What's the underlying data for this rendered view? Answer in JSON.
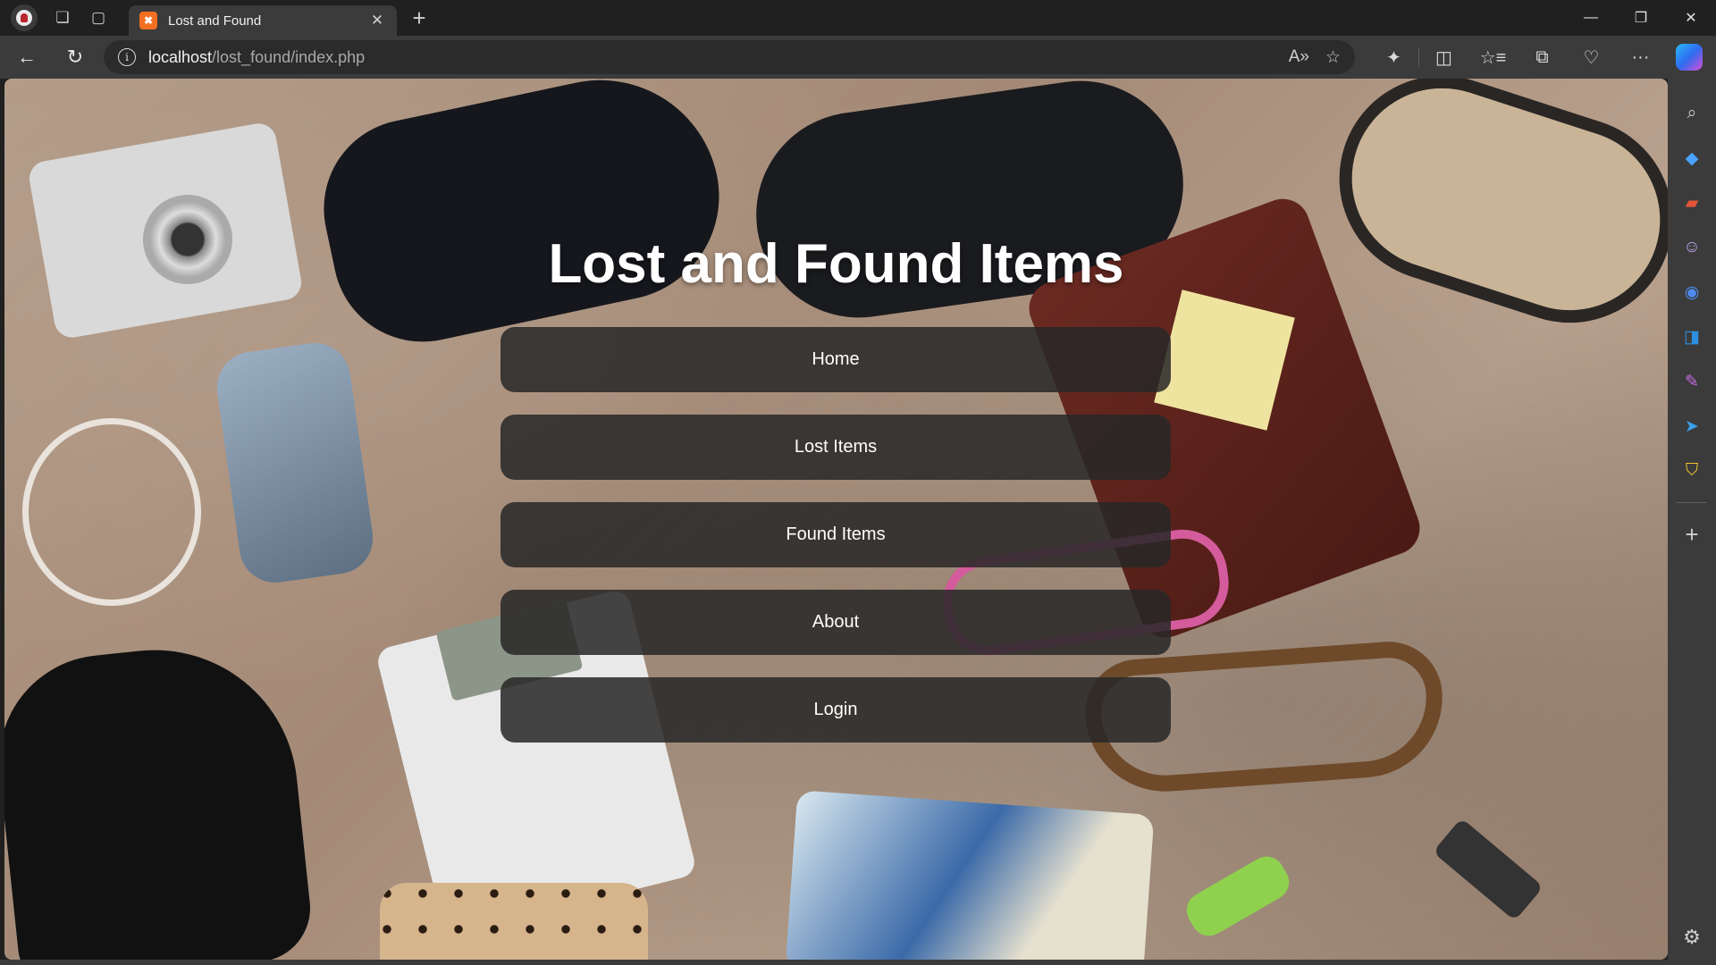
{
  "browser": {
    "tab": {
      "title": "Lost and Found",
      "favicon_text": "✖"
    },
    "address": {
      "host": "localhost",
      "path": "/lost_found/index.php"
    },
    "window_controls": {
      "minimize": "—",
      "restore": "❐",
      "close": "✕"
    },
    "nav": {
      "back": "←",
      "reload": "↻"
    },
    "omnibox_icons": {
      "read_aloud": "A»",
      "favorite": "☆"
    },
    "toolbar_icons": {
      "extensions": "✦",
      "split": "◫",
      "favorites": "☆≡",
      "collections": "⧉",
      "health": "♡",
      "more": "···"
    },
    "sidebar_icons": {
      "search": "⌕",
      "shopping": "◆",
      "tools": "▰",
      "people": "☺",
      "office": "◉",
      "outlook": "◨",
      "designer": "✎",
      "send": "➤",
      "games": "⛉",
      "add": "+",
      "settings": "⚙"
    },
    "accent": "#f36f21"
  },
  "page": {
    "title": "Lost and Found Items",
    "menu": [
      {
        "label": "Home"
      },
      {
        "label": "Lost Items"
      },
      {
        "label": "Found Items"
      },
      {
        "label": "About"
      },
      {
        "label": "Login"
      }
    ]
  }
}
